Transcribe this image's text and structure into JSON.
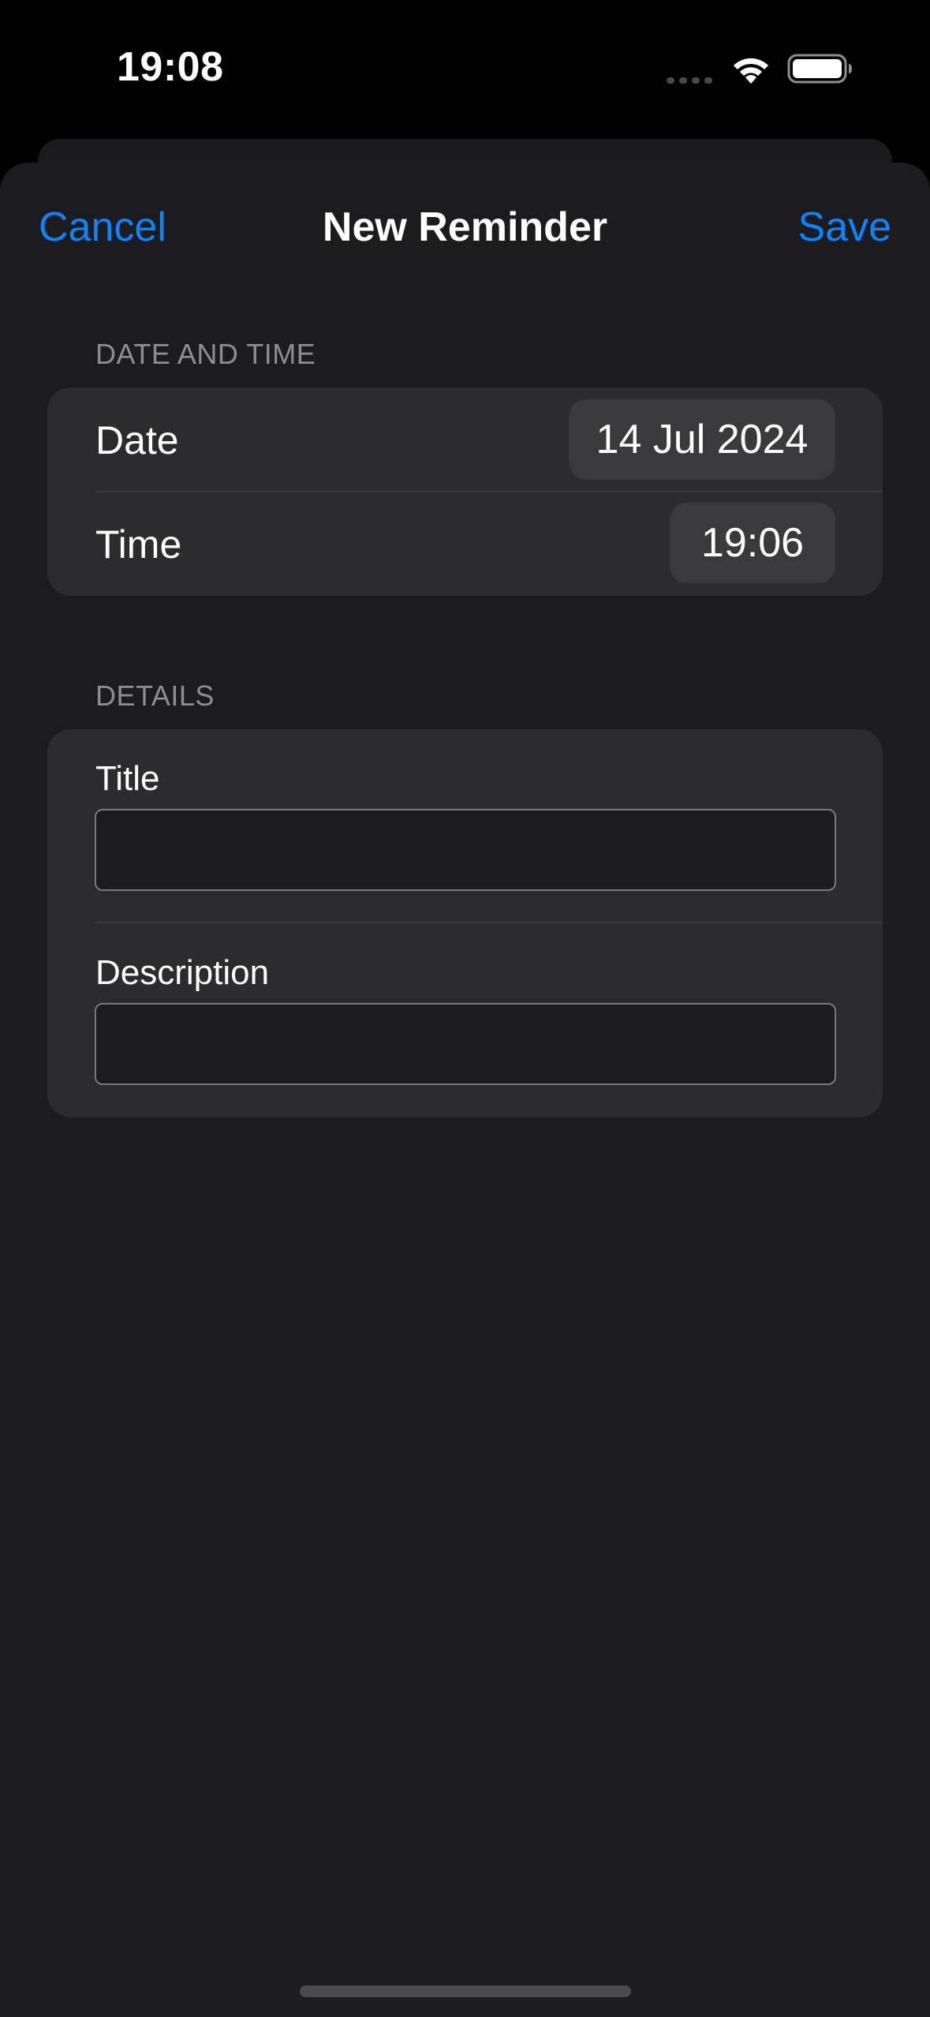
{
  "status_bar": {
    "time": "19:08",
    "icons": [
      "cellular-signal-icon",
      "wifi-icon",
      "battery-icon"
    ]
  },
  "nav": {
    "cancel_label": "Cancel",
    "title": "New Reminder",
    "save_label": "Save"
  },
  "sections": {
    "date_time": {
      "header": "DATE AND TIME",
      "date_label": "Date",
      "date_value": "14 Jul 2024",
      "time_label": "Time",
      "time_value": "19:06"
    },
    "details": {
      "header": "DETAILS",
      "title_label": "Title",
      "title_value": "",
      "description_label": "Description",
      "description_value": ""
    }
  },
  "colors": {
    "accent": "#0a84ff",
    "background": "#1c1c1e",
    "group_background": "#2c2c2e",
    "pill_background": "#3a3a3c",
    "secondary_text": "#8d8d93"
  }
}
